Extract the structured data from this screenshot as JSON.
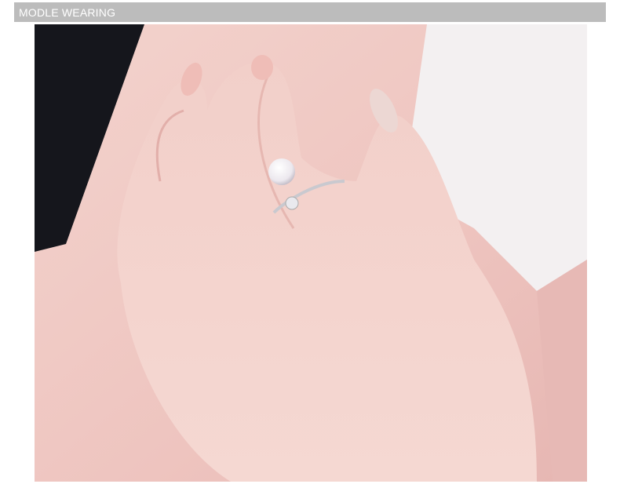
{
  "header": {
    "title": "MODLE WEARING"
  },
  "photo": {
    "subject": "hand-wearing-pearl-ring",
    "colors": {
      "skin": "#efc9c4",
      "fabric": "#f4f1f2",
      "background": "#15161c",
      "header": "#bcbcbc"
    }
  }
}
